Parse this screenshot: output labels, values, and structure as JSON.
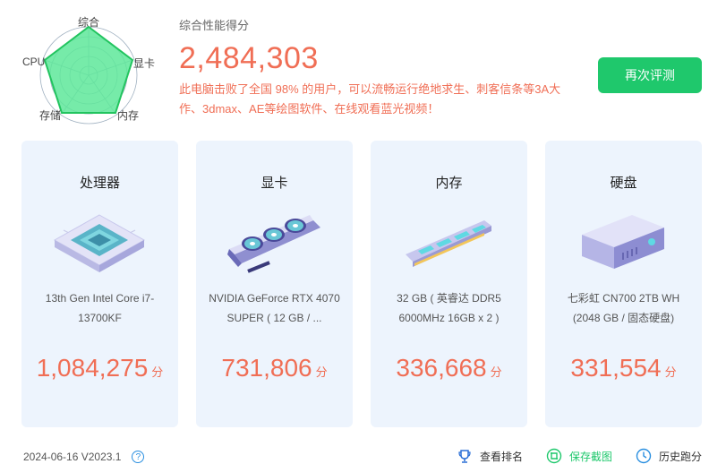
{
  "radar": {
    "labels": {
      "overall": "综合",
      "gpu": "显卡",
      "memory": "内存",
      "storage": "存储",
      "cpu": "CPU"
    },
    "fill_color": "#5ee89a",
    "stroke_color": "#22c45f"
  },
  "summary": {
    "label": "综合性能得分",
    "score": "2,484,303",
    "description": "此电脑击败了全国 98% 的用户，可以流畅运行绝地求生、刺客信条等3A大作、3dmax、AE等绘图软件、在线观看蓝光视频！"
  },
  "retest_button": "再次评测",
  "cards": [
    {
      "title": "处理器",
      "spec": "13th Gen Intel Core i7-13700KF",
      "score": "1,084,275",
      "unit": "分",
      "icon": "cpu-chip-icon"
    },
    {
      "title": "显卡",
      "spec": "NVIDIA GeForce RTX 4070 SUPER ( 12 GB / ...",
      "score": "731,806",
      "unit": "分",
      "icon": "graphics-card-icon"
    },
    {
      "title": "内存",
      "spec": "32 GB ( 英睿达 DDR5 6000MHz 16GB x 2 )",
      "score": "336,668",
      "unit": "分",
      "icon": "ram-stick-icon"
    },
    {
      "title": "硬盘",
      "spec": "七彩虹 CN700 2TB WH (2048 GB / 固态硬盘)",
      "score": "331,554",
      "unit": "分",
      "icon": "hard-drive-icon"
    }
  ],
  "footer": {
    "version": "2024-06-16 V2023.1",
    "help_icon_text": "?",
    "links": {
      "ranking": "查看排名",
      "screenshot": "保存截图",
      "history": "历史跑分"
    }
  },
  "colors": {
    "accent_green": "#1fc86c",
    "score_orange": "#f06e55",
    "card_bg": "#edf4fd"
  }
}
